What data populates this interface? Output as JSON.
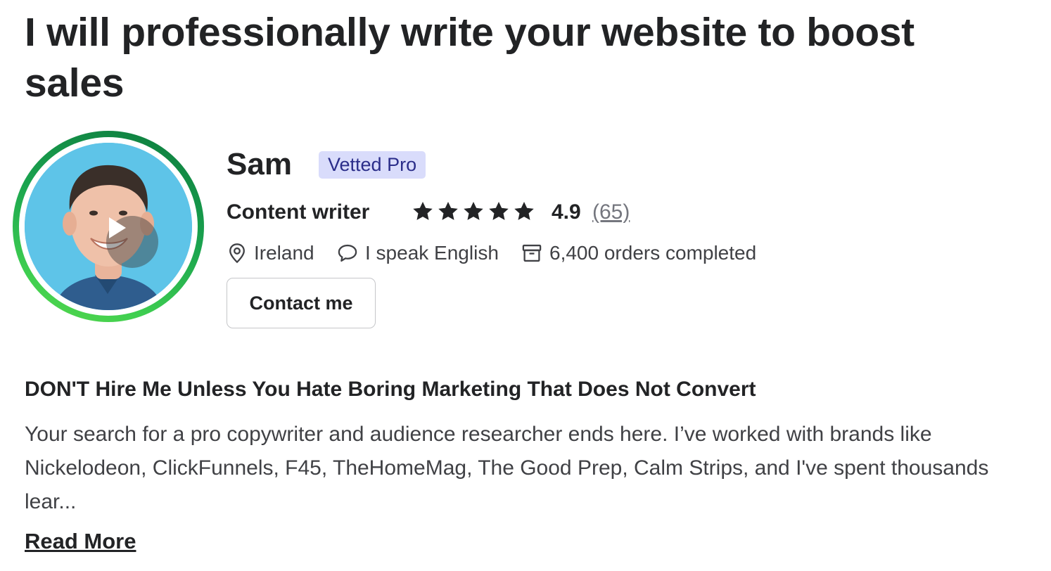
{
  "gig": {
    "title": "I will professionally write your website to boost sales"
  },
  "seller": {
    "name": "Sam",
    "badge": "Vetted Pro",
    "role": "Content writer",
    "rating": "4.9",
    "reviews": "(65)",
    "stars": 5,
    "location": "Ireland",
    "languages": "I speak English",
    "orders": "6,400 orders completed",
    "contact_label": "Contact me"
  },
  "about": {
    "headline": "DON'T Hire Me Unless You Hate Boring Marketing That Does Not Convert",
    "description": "Your search for a pro copywriter and audience researcher ends here. I’ve worked with brands like Nickelodeon, ClickFunnels, F45, TheHomeMag, The Good Prep, Calm Strips, and I've spent thousands lear...",
    "read_more": "Read More"
  },
  "icons": {
    "location": "location-pin-icon",
    "language": "chat-bubble-icon",
    "orders": "archive-box-icon",
    "star": "star-icon",
    "play": "play-icon"
  },
  "colors": {
    "badge_bg": "#d9dcfb",
    "badge_text": "#2b2e8a",
    "ring_dark": "#0d7a3e",
    "ring_light": "#59d84b",
    "avatar_bg": "#5ec4e8"
  }
}
